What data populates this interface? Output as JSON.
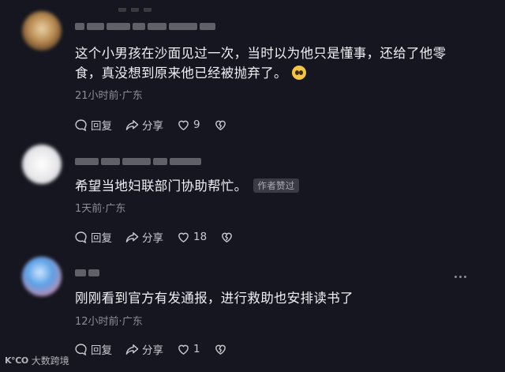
{
  "comments": [
    {
      "text": "这个小男孩在沙面见过一次，当时以为他只是懂事，还给了他零食，真没想到原来他已经被抛弃了。",
      "time": "21小时前",
      "location": "广东",
      "reply_label": "回复",
      "share_label": "分享",
      "likes": "9",
      "avatar_color": "#c9a26a"
    },
    {
      "text": "希望当地妇联部门协助帮忙。",
      "badge": "作者赞过",
      "time": "1天前",
      "location": "广东",
      "reply_label": "回复",
      "share_label": "分享",
      "likes": "18",
      "avatar_color": "#e6e6ea"
    },
    {
      "text": "刚刚看到官方有发通报，进行救助也安排读书了",
      "time": "12小时前",
      "location": "广东",
      "reply_label": "回复",
      "share_label": "分享",
      "likes": "1",
      "avatar_color": "#5aa0e6"
    }
  ],
  "meta_separator": "·",
  "watermark": {
    "logo": "K℃O",
    "text": "大数跨境"
  }
}
